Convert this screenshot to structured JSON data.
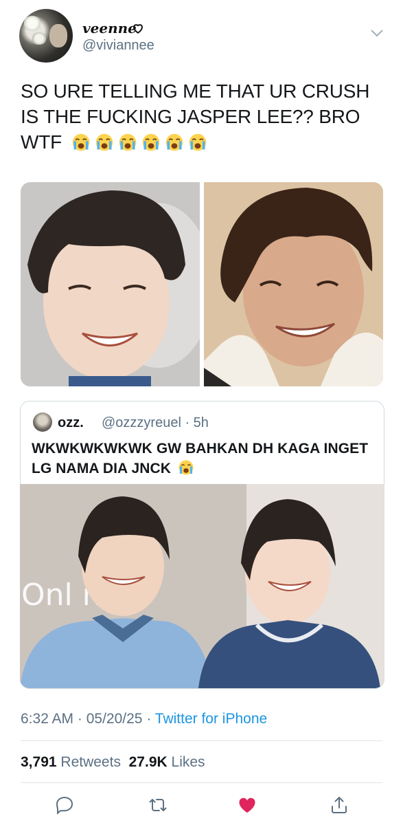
{
  "author": {
    "display_name": "veenne",
    "handle": "@viviannee"
  },
  "tweet": {
    "text": "SO URE TELLING ME THAT UR CRUSH IS THE FUCKING JASPER LEE?? BRO WTF",
    "emoji_count": 6,
    "emoji_icon": "loudly-crying-face-icon"
  },
  "quoted_tweet": {
    "name": "ozz.",
    "handle": "@ozzzyreuel",
    "time": "· 5h",
    "text": "WKWKWKWKWK GW BAHKAN DH KAGA INGET LG NAMA DIA JNCK",
    "image_caption_letters": "Onl ne"
  },
  "meta": {
    "time": "6:32 AM",
    "date": "· 05/20/25",
    "separator": " · ",
    "source": "Twitter for iPhone"
  },
  "stats": {
    "retweets_count": "3,791",
    "retweets_label": "Retweets",
    "likes_count": "27.9K",
    "likes_label": "Likes"
  },
  "colors": {
    "link": "#1b95e0",
    "secondary": "#5b7083",
    "like": "#e0245e"
  }
}
